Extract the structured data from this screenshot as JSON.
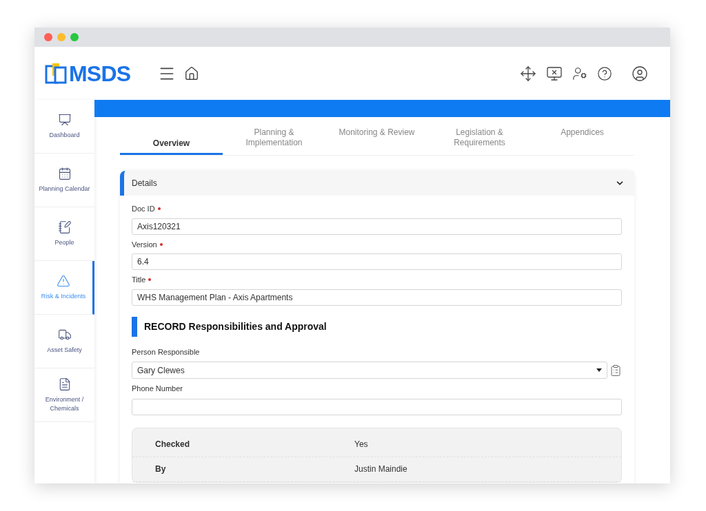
{
  "app": {
    "logo_text": "MSDS"
  },
  "sidebar": {
    "items": [
      {
        "label": "Dashboard",
        "selected": false
      },
      {
        "label": "Planning Calendar",
        "selected": false
      },
      {
        "label": "People",
        "selected": false
      },
      {
        "label": "Risk & Incidents",
        "selected": true
      },
      {
        "label": "Asset Safety",
        "selected": false
      },
      {
        "label": "Environment / Chemicals",
        "selected": false
      }
    ]
  },
  "tabs": [
    {
      "label": "Overview",
      "selected": true
    },
    {
      "label": "Planning & Implementation",
      "selected": false
    },
    {
      "label": "Monitoring & Review",
      "selected": false
    },
    {
      "label": "Legislation & Requirements",
      "selected": false
    },
    {
      "label": "Appendices",
      "selected": false
    }
  ],
  "details": {
    "title": "Details",
    "expanded": true,
    "fields": [
      {
        "label": "Doc ID",
        "required": true,
        "value": "Axis120321"
      },
      {
        "label": "Version",
        "required": true,
        "value": "6.4"
      },
      {
        "label": "Title",
        "required": true,
        "value": "WHS Management Plan - Axis Apartments"
      }
    ]
  },
  "responsibilities": {
    "heading": "RECORD Responsibilities and Approval",
    "fields": [
      {
        "kind": "select",
        "label": "Person Responsible",
        "value": "Gary Clewes"
      },
      {
        "kind": "text",
        "label": "Phone Number"
      }
    ],
    "approval": [
      {
        "label": "Checked",
        "value": "Yes"
      },
      {
        "label": "By",
        "value": "Justin Maindie"
      }
    ]
  }
}
